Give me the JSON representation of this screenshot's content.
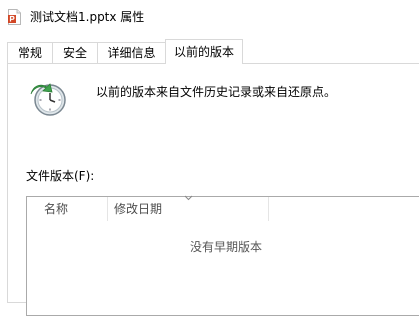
{
  "window": {
    "title": "测试文档1.pptx 属性",
    "file_icon": "powerpoint-file-icon"
  },
  "tabs": [
    {
      "label": "常规",
      "active": false
    },
    {
      "label": "安全",
      "active": false
    },
    {
      "label": "详细信息",
      "active": false
    },
    {
      "label": "以前的版本",
      "active": true
    }
  ],
  "previous_versions": {
    "icon": "restore-clock-icon",
    "description": "以前的版本来自文件历史记录或来自还原点。",
    "file_versions_label": "文件版本(F):",
    "columns": [
      "名称",
      "修改日期"
    ],
    "sort_indicator": "chevron-down-icon",
    "empty_message": "没有早期版本"
  }
}
